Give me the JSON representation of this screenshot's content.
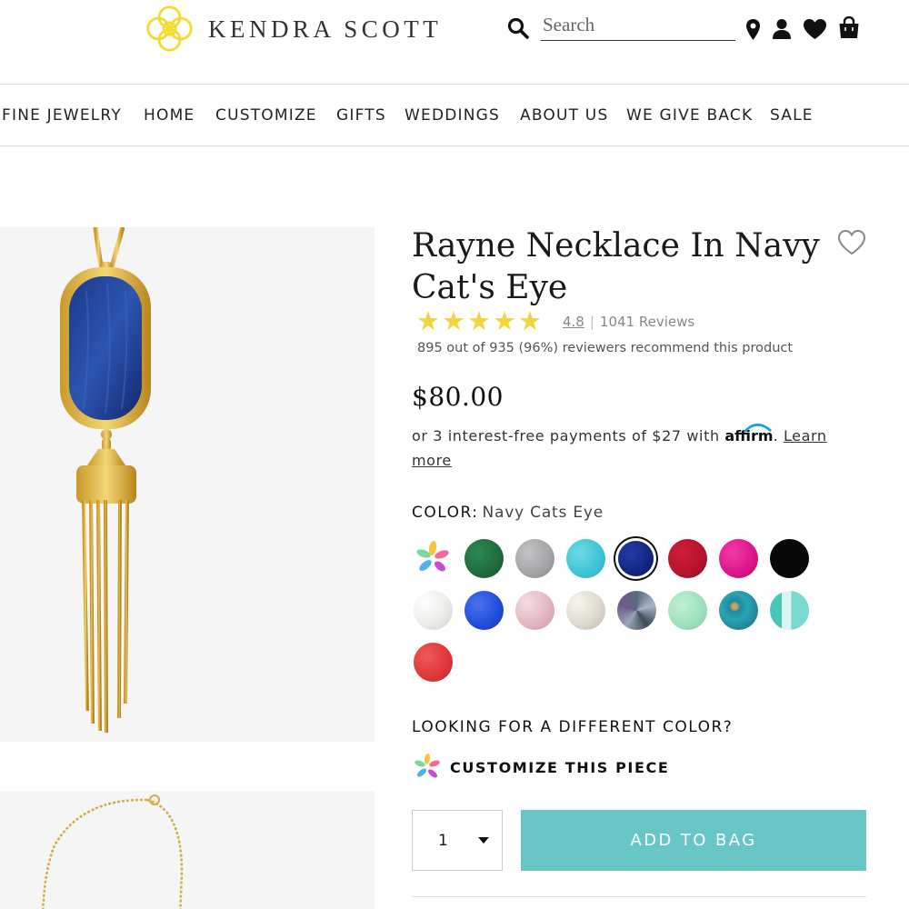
{
  "header": {
    "brand": "KENDRA SCOTT",
    "search_placeholder": "Search",
    "icons": [
      "search-icon",
      "location-pin-icon",
      "account-icon",
      "heart-icon",
      "shopping-bag-icon"
    ],
    "brand_color": "#f2dc32"
  },
  "nav": {
    "items": [
      "FINE JEWELRY",
      "HOME",
      "CUSTOMIZE",
      "GIFTS",
      "WEDDINGS",
      "ABOUT US",
      "WE GIVE BACK",
      "SALE"
    ]
  },
  "product": {
    "title": "Rayne Necklace In Navy Cat's Eye",
    "rating": {
      "stars": 5,
      "value": "4.8",
      "separator": "|",
      "reviews": "1041 Reviews",
      "recommend": "895 out of 935 (96%) reviewers recommend this product"
    },
    "price": "$80.00",
    "affirm": {
      "text": "or 3 interest-free payments of $27 with",
      "logo": "affirm",
      "period": ".",
      "link": "Learn more"
    },
    "color": {
      "label": "COLOR:",
      "value": "Navy Cats Eye",
      "selected_index": 5,
      "swatches": [
        {
          "name": "color-bar-customize",
          "color": "multi"
        },
        {
          "name": "green",
          "color": "#1f6b3c"
        },
        {
          "name": "gray",
          "color": "#a3a3a5"
        },
        {
          "name": "turquoise",
          "color": "#3cc3d5"
        },
        {
          "name": "navy-cats-eye",
          "color": "#12267f"
        },
        {
          "name": "red",
          "color": "#b4122c"
        },
        {
          "name": "magenta",
          "color": "#db138a"
        },
        {
          "name": "black",
          "color": "#080808"
        },
        {
          "name": "ivory-mother-of-pearl",
          "color": "#ececea"
        },
        {
          "name": "cobalt",
          "color": "#1f4cd8"
        },
        {
          "name": "rose-pearl",
          "color": "#e4b7c0"
        },
        {
          "name": "champagne-pearl",
          "color": "#dedad0"
        },
        {
          "name": "abalone",
          "color": "#7d8794"
        },
        {
          "name": "mint",
          "color": "#9ce0bb"
        },
        {
          "name": "teal-matrix",
          "color": "#1e8b9c"
        },
        {
          "name": "aqua-stripe",
          "color": "#7ad8cf"
        },
        {
          "name": "red-mottled",
          "color": "#e0383a"
        }
      ]
    },
    "different_color": "LOOKING FOR A DIFFERENT COLOR?",
    "customize": "CUSTOMIZE THIS PIECE",
    "quantity": "1",
    "add_to_bag": "ADD TO BAG",
    "button_color": "#68c6c6"
  }
}
